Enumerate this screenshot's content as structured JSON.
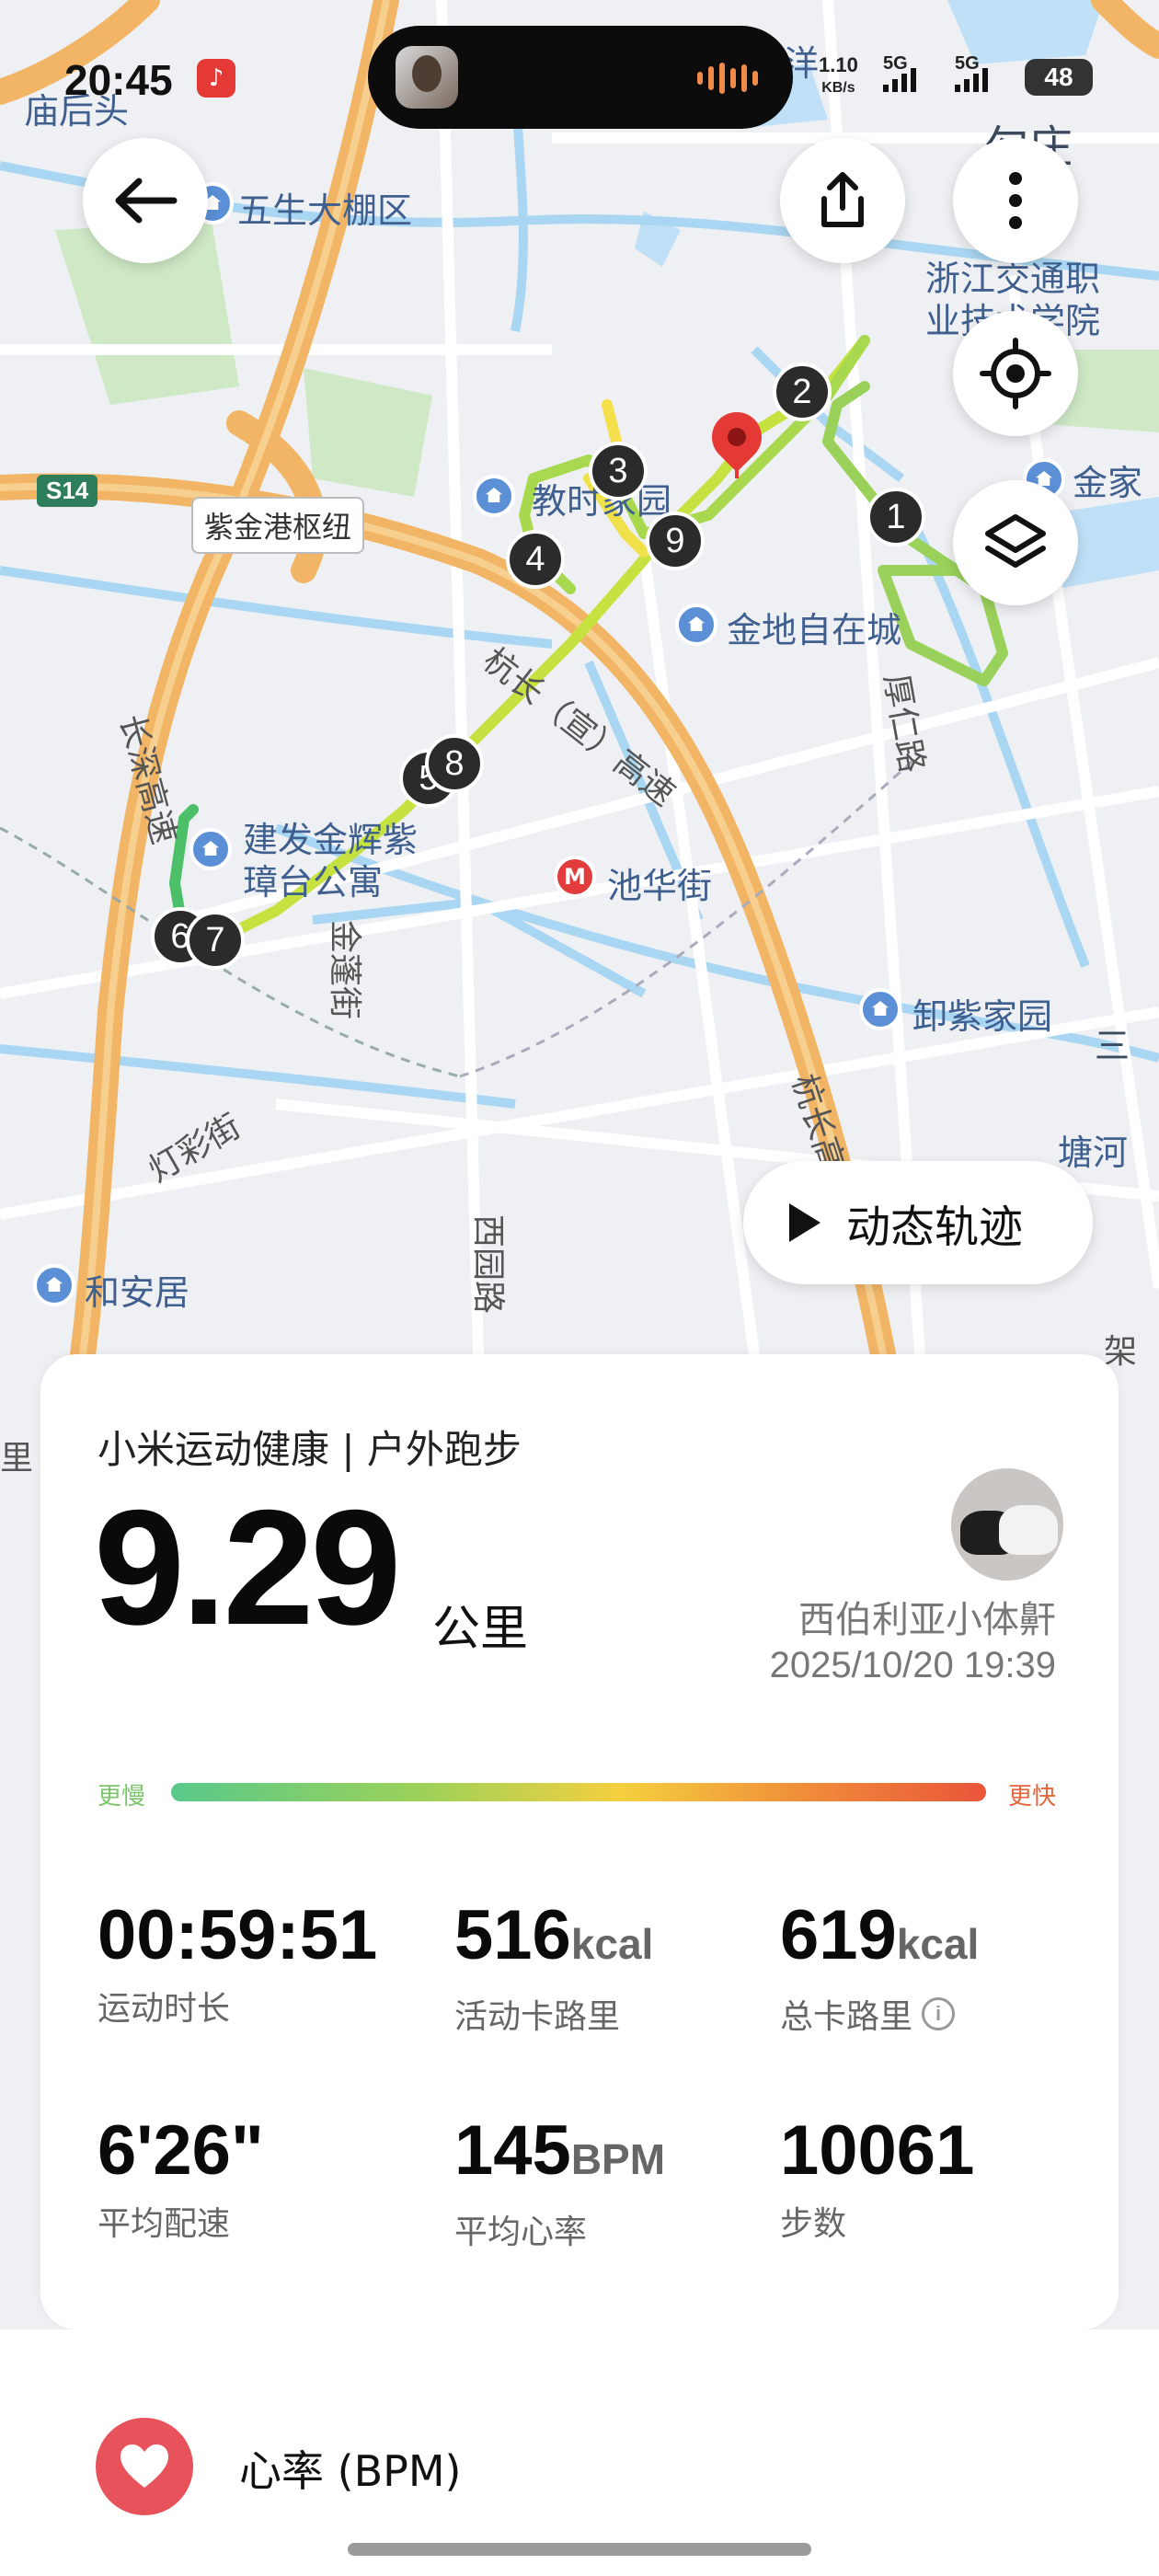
{
  "status_bar": {
    "time": "20:45",
    "net_speed_value": "1.10",
    "net_speed_unit": "KB/s",
    "sim1": "5G",
    "sim2": "5G",
    "battery": "48"
  },
  "map": {
    "labels": {
      "miaohoutou": "庙后头",
      "wusheng": "五生大棚区",
      "yang": "洋",
      "zhuang": "勾庄",
      "college_line1": "浙江交通职",
      "college_line2": "业技术学院",
      "jinjia": "金家",
      "zijingang_hub": "紫金港枢纽",
      "jiaoshi": "教时家园",
      "jindi": "金地自在城",
      "hangchang": "杭长（宣）高速",
      "changshen": "长深高速",
      "jianfa_line1": "建发金辉紫",
      "jianfa_line2": "璋台公寓",
      "chihua": "池华街",
      "jinpeng": "金蓬街",
      "houren": "厚仁路",
      "xiezi": "卸紫家园",
      "san": "三",
      "tanghe": "塘河",
      "dengcai": "灯彩街",
      "hean": "和安居",
      "xiyuan": "西园路",
      "hangchang2": "杭长高速",
      "jia": "架",
      "li": "里",
      "s14": "S14"
    },
    "km_markers": [
      "1",
      "2",
      "3",
      "4",
      "5",
      "6",
      "7",
      "8",
      "9"
    ],
    "replay_button": "动态轨迹"
  },
  "workout": {
    "source": "小米运动健康 | 户外跑步",
    "distance": "9.29",
    "distance_unit": "公里",
    "user_name": "西伯利亚小体鼾",
    "datetime": "2025/10/20 19:39",
    "pace_slow_label": "更慢",
    "pace_fast_label": "更快",
    "stats": [
      {
        "value": "00:59:51",
        "unit": "",
        "label": "运动时长"
      },
      {
        "value": "516",
        "unit": "kcal",
        "label": "活动卡路里"
      },
      {
        "value": "619",
        "unit": "kcal",
        "label": "总卡路里"
      },
      {
        "value": "6'26\"",
        "unit": "",
        "label": "平均配速"
      },
      {
        "value": "145",
        "unit": "BPM",
        "label": "平均心率"
      },
      {
        "value": "10061",
        "unit": "",
        "label": "步数"
      }
    ]
  },
  "heart_section": {
    "title": "心率 (BPM)"
  },
  "icons": {
    "back": "back-arrow-icon",
    "share": "share-icon",
    "more": "more-vertical-icon",
    "locate": "locate-icon",
    "layers": "layers-icon",
    "play": "play-icon",
    "info": "info-icon",
    "heart": "heart-icon"
  },
  "colors": {
    "route_start": "#4cc069",
    "route_mid": "#c6e240",
    "route_end": "#f0e04a",
    "marker": "#2b2b2b",
    "end_pin": "#e53935",
    "heart_bg": "#e8525a",
    "pace_slow": "#7cc46b",
    "pace_fast": "#e5643a"
  }
}
